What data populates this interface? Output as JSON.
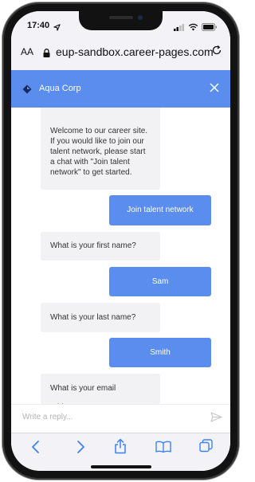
{
  "status_bar": {
    "time": "17:40"
  },
  "browser": {
    "text_size_label": "AA",
    "url": "eup-sandbox.career-pages.com"
  },
  "chat": {
    "company": "Aqua Corp",
    "messages": [
      {
        "from": "bot",
        "text": "Welcome to our career site. If you would like to join our talent network, please start a chat with \"Join talent network\" to get started."
      },
      {
        "from": "user",
        "text": "Join talent network"
      },
      {
        "from": "bot",
        "text": "What is your first name?"
      },
      {
        "from": "user",
        "text": "Sam"
      },
      {
        "from": "bot",
        "text": "What is your last name?"
      },
      {
        "from": "user",
        "text": "Smith"
      },
      {
        "from": "bot",
        "text": "What is your email address?"
      }
    ],
    "reply_placeholder": "Write a reply..."
  },
  "colors": {
    "accent": "#5b8def",
    "bot_bubble": "#f2f2f4",
    "browser_chrome": "#f2f2f7",
    "toolbar_icon": "#3d82f6"
  },
  "icons": {
    "status": [
      "location-arrow-icon",
      "signal-icon",
      "wifi-icon",
      "battery-icon"
    ],
    "browser": [
      "lock-icon",
      "reload-icon"
    ],
    "chat": [
      "company-logo-icon",
      "close-icon",
      "send-icon"
    ],
    "toolbar": [
      "back-icon",
      "forward-icon",
      "share-icon",
      "bookmarks-icon",
      "tabs-icon"
    ]
  }
}
